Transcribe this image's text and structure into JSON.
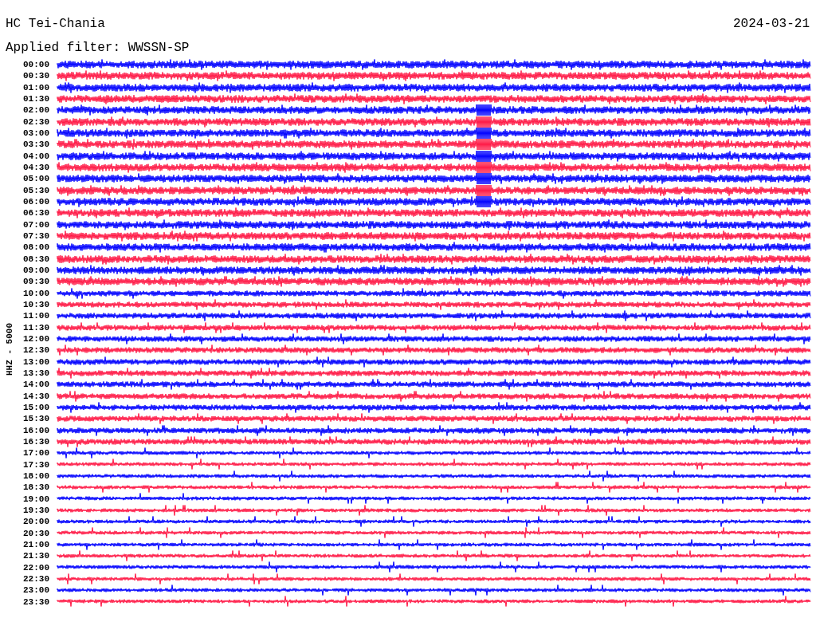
{
  "header": {
    "station": "HC Tei-Chania",
    "filter": "Applied filter: WWSSN-SP",
    "date": "2024-03-21"
  },
  "channel_label": "HHZ - 5000",
  "rows": [
    {
      "time": "00:00",
      "color": "#0000ff"
    },
    {
      "time": "00:30",
      "color": "#ff1744"
    },
    {
      "time": "01:00",
      "color": "#0000ff"
    },
    {
      "time": "01:30",
      "color": "#ff1744"
    },
    {
      "time": "02:00",
      "color": "#0000ff"
    },
    {
      "time": "02:30",
      "color": "#ff1744"
    },
    {
      "time": "03:00",
      "color": "#0000ff"
    },
    {
      "time": "03:30",
      "color": "#ff1744"
    },
    {
      "time": "04:00",
      "color": "#0000ff"
    },
    {
      "time": "04:30",
      "color": "#ff1744"
    },
    {
      "time": "05:00",
      "color": "#0000ff"
    },
    {
      "time": "05:30",
      "color": "#ff1744"
    },
    {
      "time": "06:00",
      "color": "#0000ff"
    },
    {
      "time": "06:30",
      "color": "#ff1744"
    },
    {
      "time": "07:00",
      "color": "#0000ff"
    },
    {
      "time": "07:30",
      "color": "#ff1744"
    },
    {
      "time": "08:00",
      "color": "#0000ff"
    },
    {
      "time": "08:30",
      "color": "#ff1744"
    },
    {
      "time": "09:00",
      "color": "#0000ff"
    },
    {
      "time": "09:30",
      "color": "#ff1744"
    },
    {
      "time": "10:00",
      "color": "#0000ff"
    },
    {
      "time": "10:30",
      "color": "#ff1744"
    },
    {
      "time": "11:00",
      "color": "#0000ff"
    },
    {
      "time": "11:30",
      "color": "#ff1744"
    },
    {
      "time": "12:00",
      "color": "#0000ff"
    },
    {
      "time": "12:30",
      "color": "#ff1744"
    },
    {
      "time": "13:00",
      "color": "#0000ff"
    },
    {
      "time": "13:30",
      "color": "#ff1744"
    },
    {
      "time": "14:00",
      "color": "#0000ff"
    },
    {
      "time": "14:30",
      "color": "#ff1744"
    },
    {
      "time": "15:00",
      "color": "#0000ff"
    },
    {
      "time": "15:30",
      "color": "#ff1744"
    },
    {
      "time": "16:00",
      "color": "#0000ff"
    },
    {
      "time": "16:30",
      "color": "#ff1744"
    },
    {
      "time": "17:00",
      "color": "#0000ff"
    },
    {
      "time": "17:30",
      "color": "#ff1744"
    },
    {
      "time": "18:00",
      "color": "#0000ff"
    },
    {
      "time": "18:30",
      "color": "#ff1744"
    },
    {
      "time": "19:00",
      "color": "#0000ff"
    },
    {
      "time": "19:30",
      "color": "#ff1744"
    },
    {
      "time": "20:00",
      "color": "#0000ff"
    },
    {
      "time": "20:30",
      "color": "#ff1744"
    },
    {
      "time": "21:00",
      "color": "#0000ff"
    },
    {
      "time": "21:30",
      "color": "#ff1744"
    },
    {
      "time": "22:00",
      "color": "#0000ff"
    },
    {
      "time": "22:30",
      "color": "#ff1744"
    },
    {
      "time": "23:00",
      "color": "#0000ff"
    },
    {
      "time": "23:30",
      "color": "#ff1744"
    }
  ]
}
